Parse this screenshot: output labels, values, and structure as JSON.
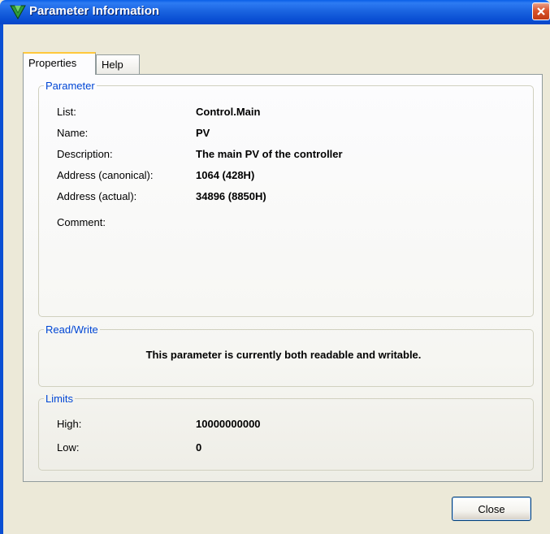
{
  "window": {
    "title": "Parameter Information"
  },
  "tabs": [
    {
      "label": "Properties",
      "active": true
    },
    {
      "label": "Help",
      "active": false
    }
  ],
  "parameter": {
    "legend": "Parameter",
    "rows": [
      {
        "label": "List:",
        "value": "Control.Main"
      },
      {
        "label": "Name:",
        "value": "PV"
      },
      {
        "label": "Description:",
        "value": "The main PV of the controller"
      },
      {
        "label": "Address (canonical):",
        "value": "1064 (428H)"
      },
      {
        "label": "Address (actual):",
        "value": "34896 (8850H)"
      },
      {
        "label": "Comment:",
        "value": ""
      }
    ]
  },
  "read_write": {
    "legend": "Read/Write",
    "text": "This parameter is currently both readable and writable."
  },
  "limits": {
    "legend": "Limits",
    "rows": [
      {
        "label": "High:",
        "value": "10000000000"
      },
      {
        "label": "Low:",
        "value": "0"
      }
    ]
  },
  "buttons": {
    "close_label": "Close"
  },
  "colors": {
    "titlebar": "#0a4fd3",
    "legend_text": "#0046d5",
    "background": "#ece9d8"
  }
}
